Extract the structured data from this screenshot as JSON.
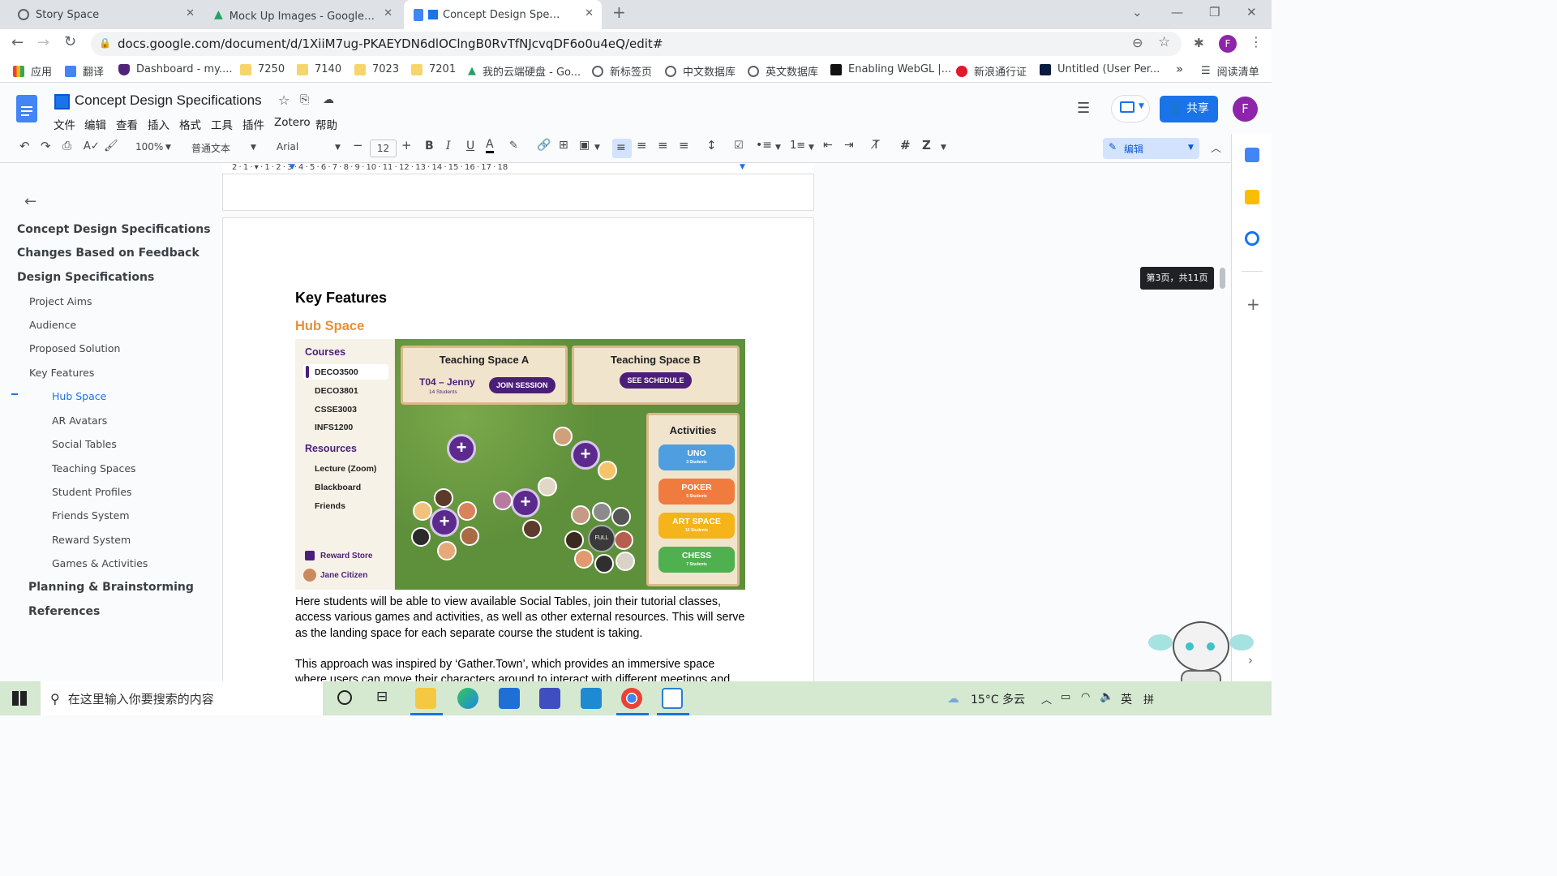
{
  "browser": {
    "tabs": [
      {
        "title": "Story Space"
      },
      {
        "title": "Mock Up Images - Google 云端"
      },
      {
        "title": "Concept Design Specificati"
      }
    ],
    "url": "docs.google.com/document/d/1XiiM7ug-PKAEYDN6dlOClngB0RvTfNJcvqDF6o0u4eQ/edit#",
    "profile_initial": "F",
    "bookmarks": [
      {
        "label": "应用",
        "icon": "apps-grid-icon"
      },
      {
        "label": "翻译",
        "icon": "translate-icon"
      },
      {
        "label": "Dashboard - my....",
        "icon": "shield-icon"
      },
      {
        "label": "7250",
        "icon": "folder-icon"
      },
      {
        "label": "7140",
        "icon": "folder-icon"
      },
      {
        "label": "7023",
        "icon": "folder-icon"
      },
      {
        "label": "7201",
        "icon": "folder-icon"
      },
      {
        "label": "我的云端硬盘 - Go...",
        "icon": "drive-icon"
      },
      {
        "label": "新标签页",
        "icon": "globe-icon"
      },
      {
        "label": "中文数据库",
        "icon": "globe-icon"
      },
      {
        "label": "英文数据库",
        "icon": "globe-icon"
      },
      {
        "label": "Enabling WebGL |...",
        "icon": "webgl-icon"
      },
      {
        "label": "新浪通行证",
        "icon": "weibo-icon"
      },
      {
        "label": "Untitled (User Per...",
        "icon": "x-icon"
      }
    ],
    "overflow": "»",
    "reading_list": "阅读清单"
  },
  "doc": {
    "title": "Concept Design Specifications",
    "menus": [
      "文件",
      "编辑",
      "查看",
      "插入",
      "格式",
      "工具",
      "插件",
      "Zotero",
      "帮助"
    ],
    "share_label": "共享",
    "user_initial": "F"
  },
  "toolbar": {
    "zoom": "100%",
    "style": "普通文本",
    "font": "Arial",
    "font_size": "12",
    "mode": "编辑"
  },
  "ruler": "2 · 1 · ▾ · 1 · 2 · 3 · 4 · 5 · 6 · 7 · 8 · 9 · 10 · 11 · 12 · 13 · 14 · 15 · 16 · 17 · 18",
  "outline": [
    {
      "label": "Concept Design Specifications",
      "level": 1
    },
    {
      "label": "Changes Based on Feedback",
      "level": 1
    },
    {
      "label": "Design Specifications",
      "level": 1
    },
    {
      "label": "Project Aims",
      "level": 2
    },
    {
      "label": "Audience",
      "level": 2
    },
    {
      "label": "Proposed Solution",
      "level": 2
    },
    {
      "label": "Key Features",
      "level": 2
    },
    {
      "label": "Hub Space",
      "level": 3,
      "active": true
    },
    {
      "label": "AR Avatars",
      "level": 3
    },
    {
      "label": "Social Tables",
      "level": 3
    },
    {
      "label": "Teaching Spaces",
      "level": 3
    },
    {
      "label": "Student Profiles",
      "level": 3
    },
    {
      "label": "Friends System",
      "level": 3
    },
    {
      "label": "Reward System",
      "level": 3
    },
    {
      "label": "Games & Activities",
      "level": 3
    },
    {
      "label": "Planning & Brainstorming",
      "level": 1
    },
    {
      "label": "References",
      "level": 1
    }
  ],
  "content": {
    "heading": "Key Features",
    "subheading": "Hub Space",
    "paragraph1": "Here students will be able to view available Social Tables, join their tutorial classes, access various games and activities, as well as other external resources. This will serve as the landing space for each separate course the student is taking.",
    "paragraph2": "This approach was inspired by ‘Gather.Town’, which provides an immersive space where users can move their characters around to interact with different meetings and"
  },
  "mockup": {
    "courses_title": "Courses",
    "courses": [
      "DECO3500",
      "DECO3801",
      "CSSE3003",
      "INFS1200"
    ],
    "resources_title": "Resources",
    "resources": [
      "Lecture (Zoom)",
      "Blackboard",
      "Friends"
    ],
    "reward_store": "Reward Store",
    "user_name": "Jane Citizen",
    "space_a": {
      "title": "Teaching Space A",
      "session": "T04 – Jenny",
      "students": "14 Students",
      "button": "JOIN SESSION"
    },
    "space_b": {
      "title": "Teaching Space B",
      "button": "SEE SCHEDULE"
    },
    "full_label": "FULL",
    "activities_title": "Activities",
    "activities": [
      {
        "label": "UNO",
        "sub": "3 Students",
        "color": "#4f9fe0"
      },
      {
        "label": "POKER",
        "sub": "5 Students",
        "color": "#f07b3f"
      },
      {
        "label": "ART SPACE",
        "sub": "16 Students",
        "color": "#f4b41a"
      },
      {
        "label": "CHESS",
        "sub": "7 Students",
        "color": "#4fb04f"
      }
    ]
  },
  "tooltip": "第3页，共11页",
  "taskbar": {
    "search_placeholder": "在这里输入你要搜索的内容",
    "weather": "15°C 多云",
    "ime": "英"
  }
}
